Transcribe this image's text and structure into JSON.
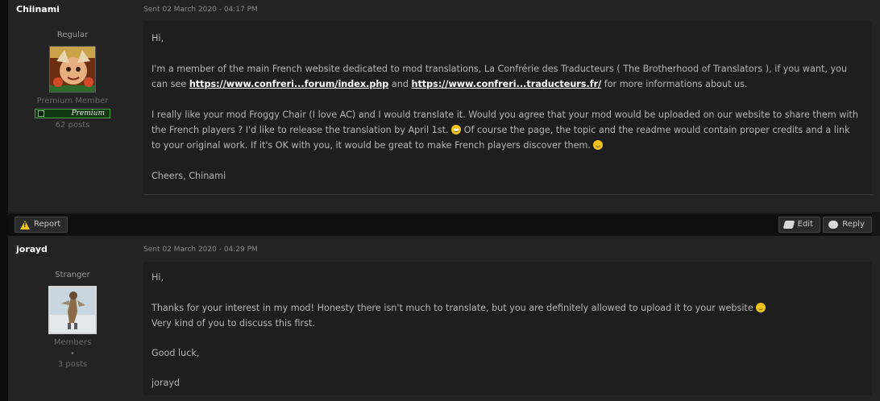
{
  "posts": [
    {
      "author": "Chiinami",
      "sent": "Sent 02 March 2020 - 04:17 PM",
      "rank": "Regular",
      "group": "Premium Member",
      "badge": "Premium",
      "post_count": "62 posts",
      "greeting": "Hi,",
      "para1_a": "I'm a member of the main French website dedicated to mod translations, La Confrérie des Traducteurs ( The Brotherhood of Translators ), if you want, you",
      "para1_b_pre": "can see",
      "link1": "https://www.confreri...forum/index.php",
      "para1_and": "and",
      "link2": "https://www.confreri...traducteurs.fr/",
      "para1_b_post": "for more informations about us.",
      "para2_a": "I really like your mod Froggy Chair (I love AC) and I would translate it. Would you agree that your mod would be uploaded on our website to share them with",
      "para2_b": "the French players ? I'd like to release the translation by April 1st.",
      "para2_b2": "Of course the page, the topic and the readme would contain proper credits and a link",
      "para2_c": "to your original work. If it's OK with you, it would be great to make French players discover them.",
      "closing": "Cheers, Chinami"
    },
    {
      "author": "jorayd",
      "sent": "Sent 02 March 2020 - 04:29 PM",
      "rank": "Stranger",
      "group": "Members",
      "dot": "•",
      "post_count": "3 posts",
      "greeting": "Hi,",
      "line1": "Thanks for your interest in my mod! Honesty there isn't much to translate, but you are definitely allowed to upload it to your website",
      "line2": "Very kind of you to discuss this first.",
      "line3": "Good luck,",
      "signoff": "jorayd"
    }
  ],
  "actions": {
    "report": "Report",
    "edit": "Edit",
    "reply": "Reply"
  },
  "icons": {
    "report": "warning-icon",
    "edit": "edit-icon",
    "reply": "reply-icon",
    "smiley_color": "#f0c419"
  }
}
